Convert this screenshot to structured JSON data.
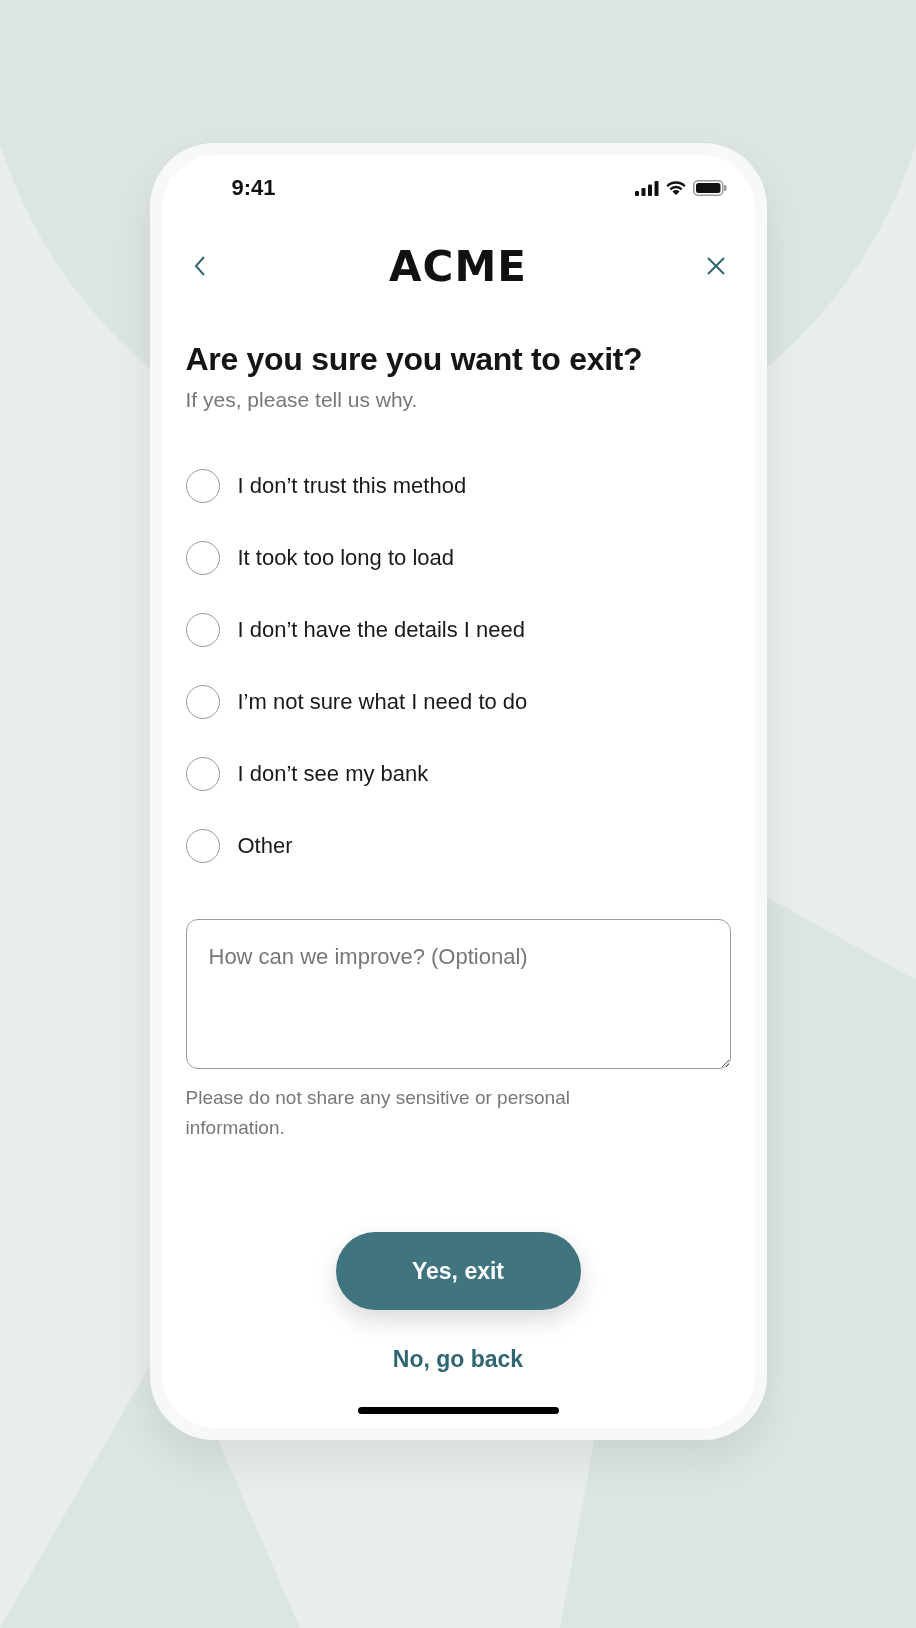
{
  "status_bar": {
    "time": "9:41"
  },
  "header": {
    "logo": "ACME"
  },
  "title": "Are you sure you want to exit?",
  "subtitle": "If yes, please tell us why.",
  "reasons": [
    {
      "label": "I don’t trust this method",
      "selected": false
    },
    {
      "label": "It took too long to load",
      "selected": false
    },
    {
      "label": "I don’t have the details I need",
      "selected": false
    },
    {
      "label": "I’m not sure what I need to do",
      "selected": false
    },
    {
      "label": "I don’t see my bank",
      "selected": false
    },
    {
      "label": "Other",
      "selected": false
    }
  ],
  "feedback": {
    "placeholder": "How can we improve? (Optional)"
  },
  "note": "Please do not share any sensitive or personal information.",
  "primary_button": "Yes, exit",
  "secondary_link": "No, go back"
}
